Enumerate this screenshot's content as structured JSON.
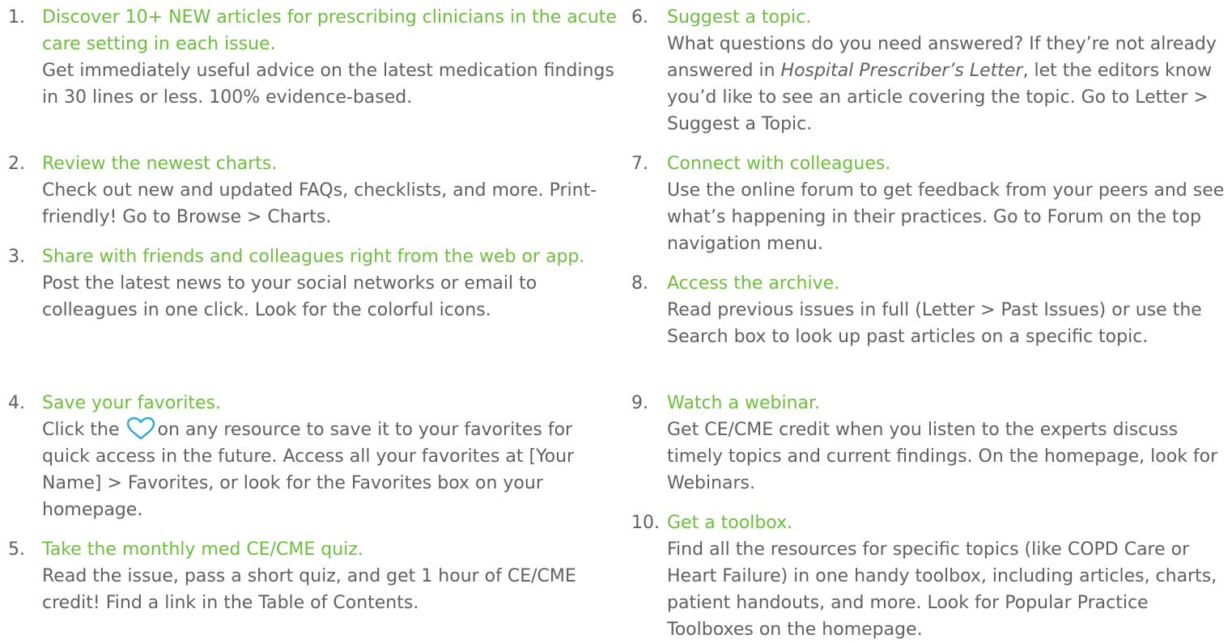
{
  "left_items": [
    {
      "number": "1.",
      "title": "Discover 10+ NEW articles for prescribing clinicians in the acute care setting in each issue.",
      "desc": "Get immediately useful advice on the latest medication findings in 30 lines or less. 100% evidence-based."
    },
    {
      "number": "2.",
      "title": "Review the newest charts.",
      "desc": "Check out new and updated FAQs, checklists, and more. Print-friendly! Go to Browse > Charts."
    },
    {
      "number": "3.",
      "title": "Share with friends and colleagues right from the web or app.",
      "desc": "Post the latest news to your social networks or email to colleagues in one click. Look for the colorful icons."
    },
    {
      "number": "4.",
      "title": "Save your favorites.",
      "desc_before": "Click the",
      "desc_after": "on any resource to save it to your favorites for quick access in the future. Access all your favorites at [Your Name] > Favorites, or look for the Favorites box on your homepage."
    },
    {
      "number": "5.",
      "title": "Take the monthly med CE/CME quiz.",
      "desc": "Read the issue, pass a short quiz, and get 1 hour of CE/CME credit! Find a link in the Table of Contents."
    }
  ],
  "right_items": [
    {
      "number": "6.",
      "title": "Suggest a topic.",
      "desc_before": "What questions do you need answered? If they’re not already answered in",
      "desc_italic": "Hospital Prescriber’s Letter",
      "desc_after": ", let the editors know you’d like to see an article covering the topic. Go to Letter > Suggest a Topic."
    },
    {
      "number": "7.",
      "title": "Connect with colleagues.",
      "desc": "Use the online forum to get feedback from your peers and see what’s happening in their practices. Go to Forum on the top navigation menu."
    },
    {
      "number": "8.",
      "title": "Access the archive.",
      "desc": "Read previous issues in full (Letter > Past Issues) or use the Search box to look up past articles on a specific topic."
    },
    {
      "number": "9.",
      "title": "Watch a webinar.",
      "desc": "Get CE/CME credit when you listen to the experts discuss timely topics and current findings. On the homepage, look for Webinars."
    },
    {
      "number": "10.",
      "title": "Get a toolbox.",
      "desc": "Find all the resources for specific topics (like COPD Care or Heart Failure) in one handy toolbox, including articles, charts, patient handouts, and more. Look for Popular Practice Toolboxes on the homepage."
    }
  ],
  "colors": {
    "title_green": "#6bbf3b",
    "body_gray": "#5f6062",
    "heart_blue": "#2fa8d8"
  },
  "icons": {
    "heart": "heart-outline-icon"
  }
}
